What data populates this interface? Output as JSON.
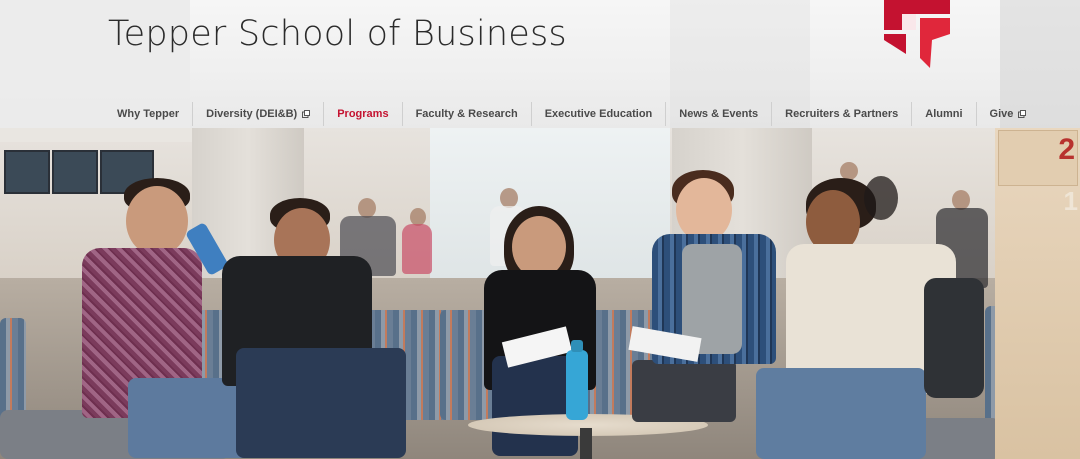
{
  "header": {
    "title": "Tepper School of Business"
  },
  "logo": {
    "icon": "tepper-t-logo-icon",
    "color": "#c41230"
  },
  "nav": {
    "items": [
      {
        "label": "Why Tepper",
        "active": false,
        "external": false
      },
      {
        "label": "Diversity (DEI&B)",
        "active": false,
        "external": true
      },
      {
        "label": "Programs",
        "active": true,
        "external": false
      },
      {
        "label": "Faculty & Research",
        "active": false,
        "external": false
      },
      {
        "label": "Executive Education",
        "active": false,
        "external": false
      },
      {
        "label": "News & Events",
        "active": false,
        "external": false
      },
      {
        "label": "Recruiters & Partners",
        "active": false,
        "external": false
      },
      {
        "label": "Alumni",
        "active": false,
        "external": false
      },
      {
        "label": "Give",
        "active": false,
        "external": true
      }
    ],
    "active_color": "#c41230",
    "text_color": "#4a4a4a"
  },
  "hero": {
    "image": "students-in-lounge-photo",
    "sign_number_top": "2",
    "sign_number_side": "1"
  }
}
